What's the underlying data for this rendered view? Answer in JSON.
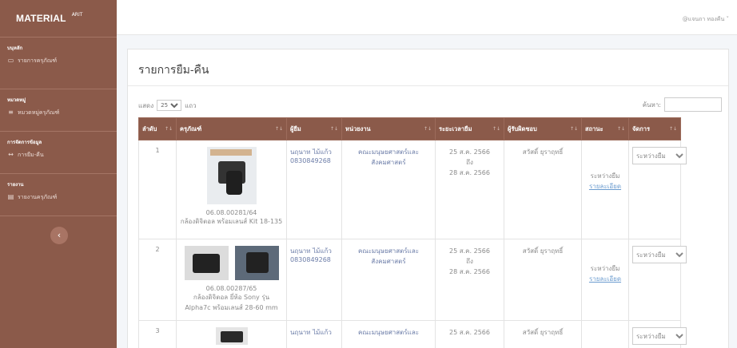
{
  "sidebar": {
    "brand": "MATERIAL",
    "brand_sup": "ARIT",
    "sections": [
      {
        "title": "บนุหลัก",
        "item": "รายการครุภัณฑ์",
        "icon": "monitor-icon"
      },
      {
        "title": "หมวดหมู่",
        "item": "หมวดหมู่ครุภัณฑ์",
        "icon": "list-icon"
      },
      {
        "title": "การจัดการข้อมูล",
        "item": "การยืม-คืน",
        "icon": "swap-icon"
      },
      {
        "title": "รายงาน",
        "item": "รายงานครุภัณฑ์",
        "icon": "file-icon"
      }
    ],
    "collapse_glyph": "‹"
  },
  "topbar": {
    "user": "@แจนถา ทองคืน ˅"
  },
  "page": {
    "title": "รายการยืม-คืน",
    "show_prefix": "แสดง",
    "show_value": "25",
    "show_suffix": "แถว",
    "search_label": "ค้นหา:"
  },
  "table": {
    "headers": [
      "ลำดับ",
      "ครุภัณฑ์",
      "ผู้ยืม",
      "หน่วยงาน",
      "ระยะเวลายืม",
      "ผู้รับผิดชอบ",
      "สถานะ",
      "จัดการ"
    ],
    "sort_first": "↑↓",
    "sort_other": "↑↓",
    "rows": [
      {
        "no": "1",
        "code": "06.08.00281/64",
        "name": "กล้องดิจิตอล พร้อมเลนส์ Kit 18-135",
        "borrower_name": "นฤนาท ไม้แก้ว",
        "borrower_phone": "0830849268",
        "dept": "คณะมนุษยศาสตร์และสังคมศาสตร์",
        "date_from": "25 ส.ค. 2566",
        "date_to_word": "ถึง",
        "date_to": "28 ส.ค. 2566",
        "owner": "สวัสดิ์ ยุราฤทธิ์",
        "status": "ระหว่างยืม",
        "detail": "รายละเอียด",
        "action": "ระหว่างยืม"
      },
      {
        "no": "2",
        "code": "06.08.00287/65",
        "name": "กล้องดิจิตอล ยี่ห้อ Sony รุ่น Alpha7c พร้อมเลนส์ 28-60 mm",
        "borrower_name": "นฤนาท ไม้แก้ว",
        "borrower_phone": "0830849268",
        "dept": "คณะมนุษยศาสตร์และสังคมศาสตร์",
        "date_from": "25 ส.ค. 2566",
        "date_to_word": "ถึง",
        "date_to": "28 ส.ค. 2566",
        "owner": "สวัสดิ์ ยุราฤทธิ์",
        "status": "ระหว่างยืม",
        "detail": "รายละเอียด",
        "action": "ระหว่างยืม"
      },
      {
        "no": "3",
        "borrower_name": "นฤนาท ไม้แก้ว",
        "dept": "คณะมนุษยศาสตร์และ",
        "date_from": "25 ส.ค. 2566",
        "owner": "สวัสดิ์ ยุราฤทธิ์",
        "action": "ระหว่างยืม"
      }
    ]
  },
  "colors": {
    "sidebar": "#8b5a4a",
    "header": "#8b5a4a",
    "link": "#6a9bcf"
  }
}
